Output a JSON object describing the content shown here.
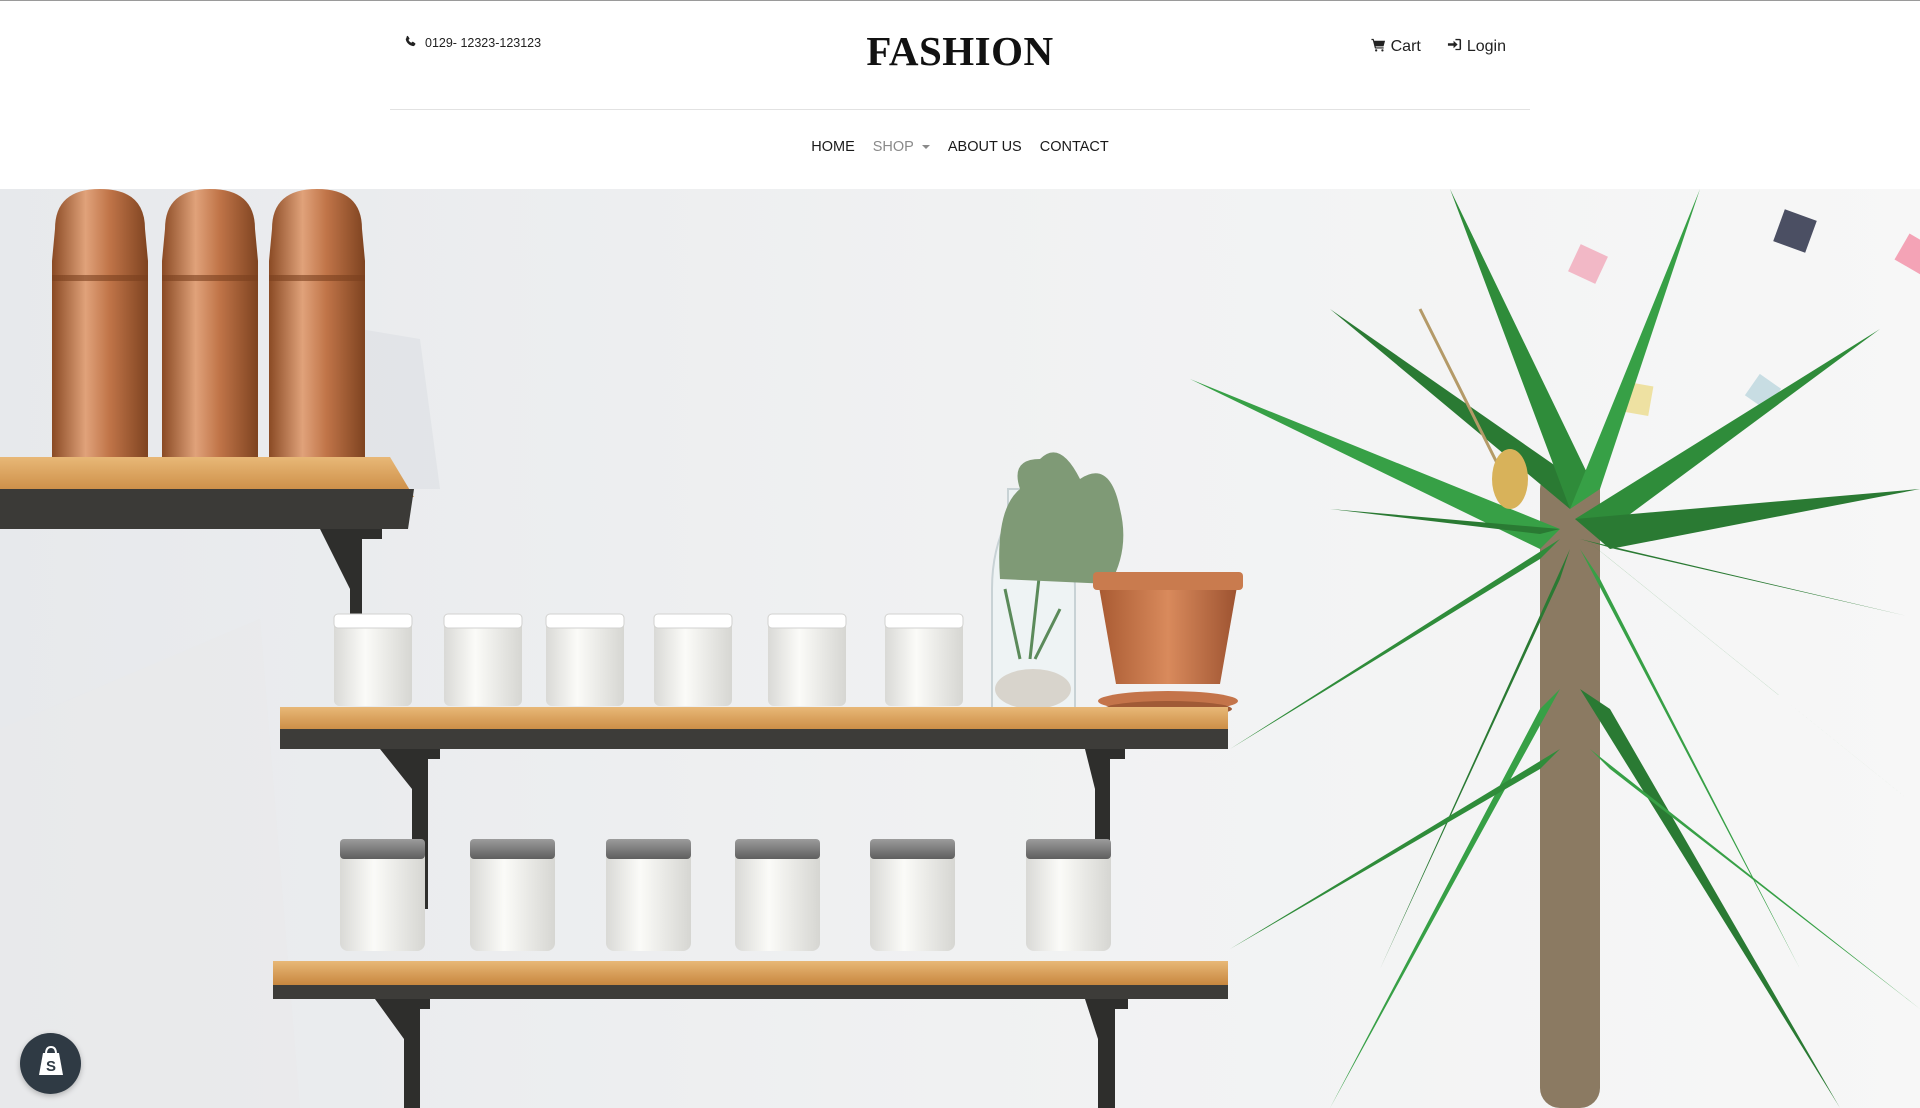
{
  "header": {
    "phone_icon": "phone-icon",
    "phone": "0129- 12323-123123",
    "logo": "FASHION",
    "cart_icon": "cart-icon",
    "cart_label": "Cart",
    "login_icon": "sign-in-icon",
    "login_label": "Login"
  },
  "nav": {
    "items": [
      {
        "label": "HOME"
      },
      {
        "label": "SHOP",
        "has_dropdown": true
      },
      {
        "label": "ABOUT US"
      },
      {
        "label": "CONTACT"
      }
    ]
  },
  "hero": {
    "image": "shelves-with-copper-bottles-candles-cactus-and-palm-plant"
  },
  "badge": {
    "icon": "shopify-bag-icon"
  },
  "colors": {
    "background": "#ffffff",
    "text": "#222222",
    "nav_muted": "#8a8a8a",
    "badge": "#2f3a44",
    "wall": "#eeeff0",
    "wood": "#d9a05a",
    "copper": "#c8825a",
    "leaf": "#2e8b3a"
  }
}
